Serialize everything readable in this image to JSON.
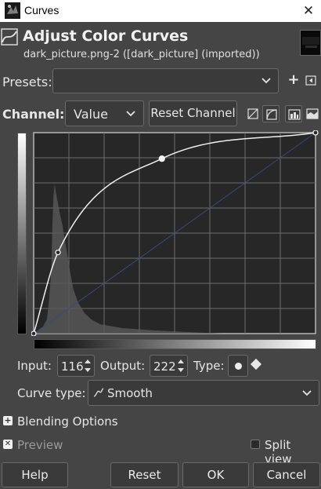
{
  "window": {
    "title": "Curves"
  },
  "header": {
    "title": "Adjust Color Curves",
    "subtitle": "dark_picture.png-2 ([dark_picture] (imported))"
  },
  "presets": {
    "label": "Presets:",
    "value": ""
  },
  "channel": {
    "label": "Channel:",
    "value": "Value",
    "reset_label": "Reset Channel"
  },
  "curve": {
    "selected_point": {
      "input": 116,
      "output": 222
    },
    "points": [
      [
        0,
        0
      ],
      [
        22,
        103
      ],
      [
        116,
        222
      ],
      [
        255,
        255
      ]
    ],
    "line_color": "#f0f0f0",
    "diagonal_color": "#3a4a7a"
  },
  "io": {
    "input_label": "Input:",
    "input_value": "116",
    "output_label": "Output:",
    "output_value": "222",
    "type_label": "Type:"
  },
  "curve_type": {
    "label": "Curve type:",
    "value": "Smooth"
  },
  "blending": {
    "label": "Blending Options"
  },
  "preview": {
    "label": "Preview",
    "checked": true
  },
  "split_view": {
    "label": "Split view",
    "checked": false
  },
  "buttons": {
    "help": "Help",
    "reset": "Reset",
    "ok": "OK",
    "cancel": "Cancel"
  },
  "icons": {
    "app": "gimp-wilber-icon",
    "curves": "curves-icon",
    "add": "add-preset-icon",
    "menu": "preset-menu-icon",
    "linear": "linear-histogram-icon",
    "log": "logarithmic-histogram-icon",
    "graph_bg": "histogram-background-icon",
    "graph_fg": "histogram-foreground-icon"
  }
}
